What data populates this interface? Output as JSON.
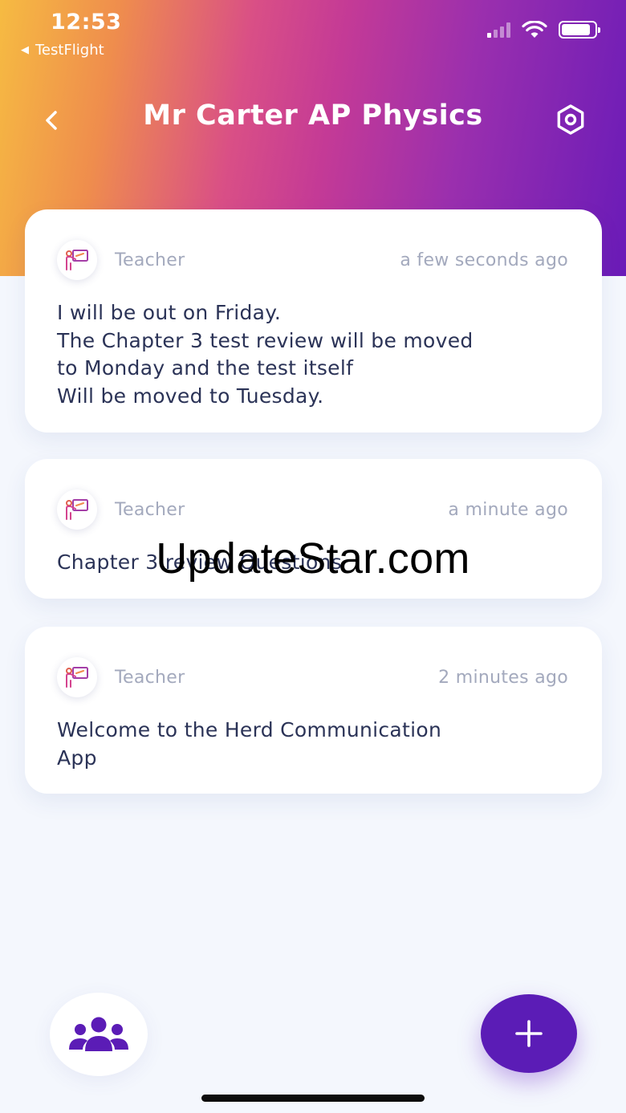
{
  "status_bar": {
    "time": "12:53",
    "back_app": "TestFlight",
    "back_arrow": "◀"
  },
  "header": {
    "title": "Mr Carter AP Physics",
    "back_icon": "chevron-left-icon",
    "settings_icon": "settings-hexagon-icon"
  },
  "messages": [
    {
      "author": "Teacher",
      "time": "a few seconds ago",
      "text": "I will be out on Friday.\nThe Chapter 3 test review will be moved\nto Monday and the test itself\nWill be moved to Tuesday."
    },
    {
      "author": "Teacher",
      "time": "a minute ago",
      "text": "Chapter 3 review Questions"
    },
    {
      "author": "Teacher",
      "time": "2 minutes ago",
      "text": "Welcome to the Herd Communication\nApp"
    }
  ],
  "watermark": "UpdateStar.com",
  "fab": {
    "label": "+"
  },
  "colors": {
    "gradient_start": "#f6bb42",
    "gradient_mid": "#c43a96",
    "gradient_end": "#6a1bb8",
    "accent": "#5b1cb6",
    "muted_text": "#a3a9bd",
    "body_text": "#2b3357"
  }
}
